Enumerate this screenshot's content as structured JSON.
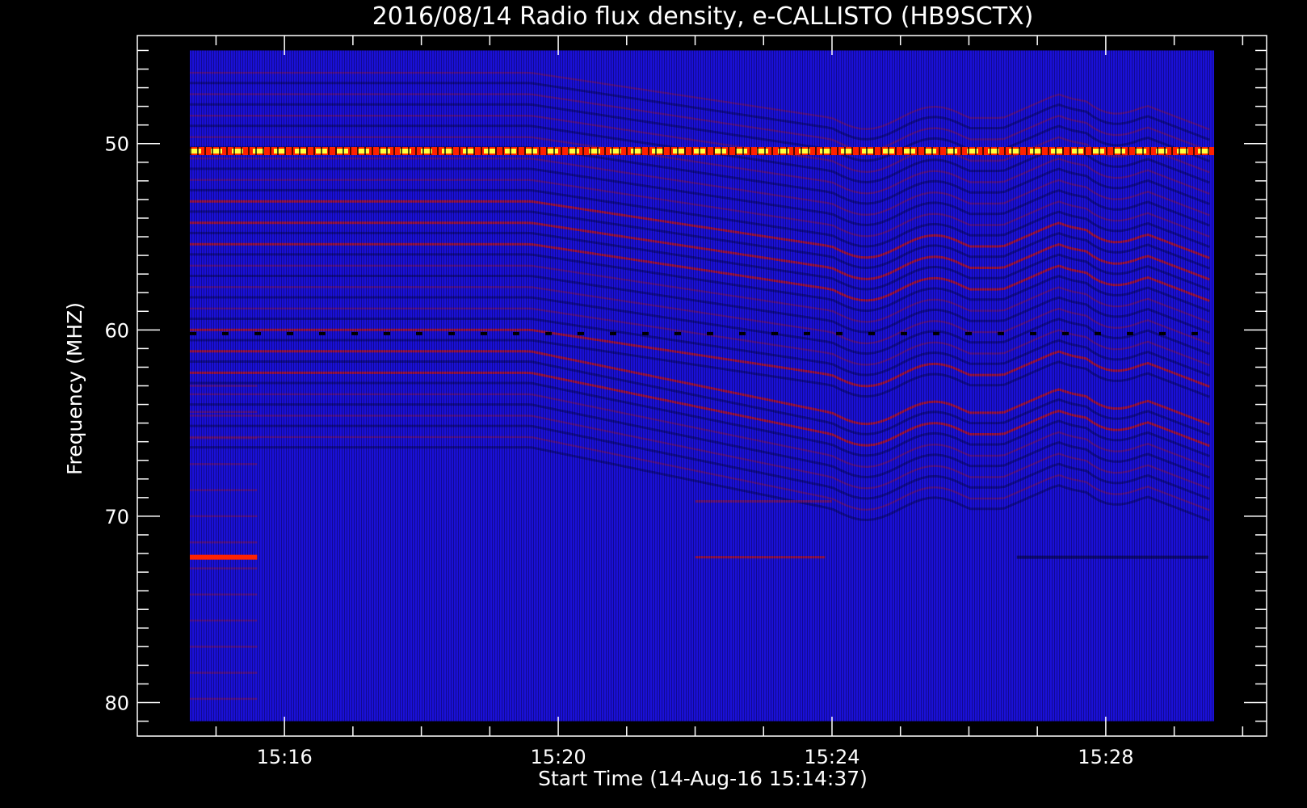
{
  "chart_data": {
    "type": "heatmap",
    "title": "2016/08/14  Radio flux density, e-CALLISTO (HB9SCTX)",
    "xlabel": "Start Time (14-Aug-16 15:14:37)",
    "ylabel": "Frequency (MHZ)",
    "x_ticks": [
      "15:16",
      "15:20",
      "15:24",
      "15:28"
    ],
    "x_tick_minutes": [
      16,
      20,
      24,
      28
    ],
    "x_start_minutes": 14.617,
    "x_end_minutes": 29.583,
    "xlim_minutes": [
      13.85,
      30.35
    ],
    "y_ticks": [
      50,
      60,
      70,
      80
    ],
    "ylim": [
      44.2,
      81.8
    ],
    "data_range_mhz": [
      45.0,
      81.0
    ],
    "colors": {
      "background": "#000000",
      "axis": "#ffffff",
      "low": "#1a0fd8",
      "mid": "#7a1566",
      "high": "#ff2200",
      "peak": "#ffff40"
    },
    "features": [
      {
        "name": "constant carrier (RFI)",
        "freq_mhz": 50.4,
        "intensity": "peak"
      },
      {
        "name": "constant carrier",
        "freq_mhz": 72.2,
        "t_start": 14.617,
        "t_end": 15.6,
        "intensity": "high"
      },
      {
        "name": "dark interference line",
        "freq_mhz": 60.2,
        "intensity": "low"
      },
      {
        "name": "drifting bands",
        "freq_range_mhz": [
          46,
          67
        ],
        "t_range": [
          19.8,
          29.58
        ],
        "intensity": "mid"
      }
    ]
  }
}
